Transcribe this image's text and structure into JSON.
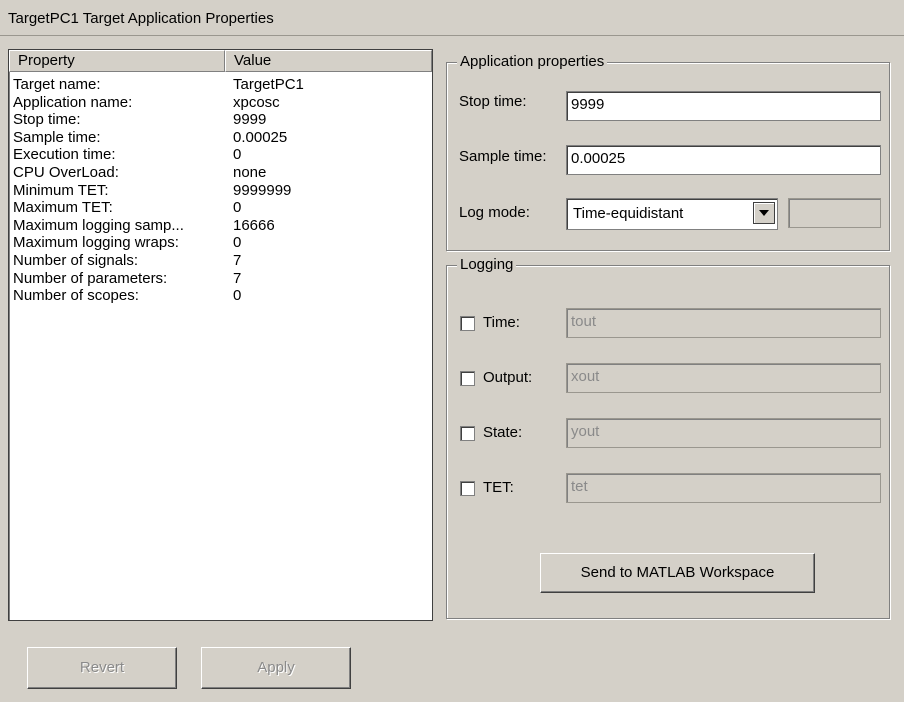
{
  "window": {
    "title": "TargetPC1 Target Application Properties"
  },
  "table": {
    "headers": [
      "Property",
      "Value"
    ],
    "rows": [
      {
        "property": "Target name:",
        "value": "TargetPC1"
      },
      {
        "property": "Application name:",
        "value": "xpcosc"
      },
      {
        "property": "Stop time:",
        "value": "9999"
      },
      {
        "property": "Sample time:",
        "value": "0.00025"
      },
      {
        "property": "Execution time:",
        "value": "0"
      },
      {
        "property": "CPU OverLoad:",
        "value": "none"
      },
      {
        "property": "Minimum TET:",
        "value": "9999999"
      },
      {
        "property": "Maximum TET:",
        "value": "0"
      },
      {
        "property": "Maximum logging samp...",
        "value": "16666"
      },
      {
        "property": "Maximum logging wraps:",
        "value": "0"
      },
      {
        "property": "Number of signals:",
        "value": "7"
      },
      {
        "property": "Number of parameters:",
        "value": "7"
      },
      {
        "property": "Number of scopes:",
        "value": "0"
      }
    ]
  },
  "app_props": {
    "legend": "Application properties",
    "stop_time_label": "Stop time:",
    "stop_time_value": "9999",
    "sample_time_label": "Sample time:",
    "sample_time_value": "0.00025",
    "log_mode_label": "Log mode:",
    "log_mode_value": "Time-equidistant",
    "log_mode_extra_value": ""
  },
  "logging": {
    "legend": "Logging",
    "items": [
      {
        "label": "Time:",
        "value": "tout",
        "checked": false
      },
      {
        "label": "Output:",
        "value": "xout",
        "checked": false
      },
      {
        "label": "State:",
        "value": "yout",
        "checked": false
      },
      {
        "label": "TET:",
        "value": "tet",
        "checked": false
      }
    ],
    "send_button": "Send to MATLAB Workspace"
  },
  "footer": {
    "revert": "Revert",
    "apply": "Apply"
  }
}
